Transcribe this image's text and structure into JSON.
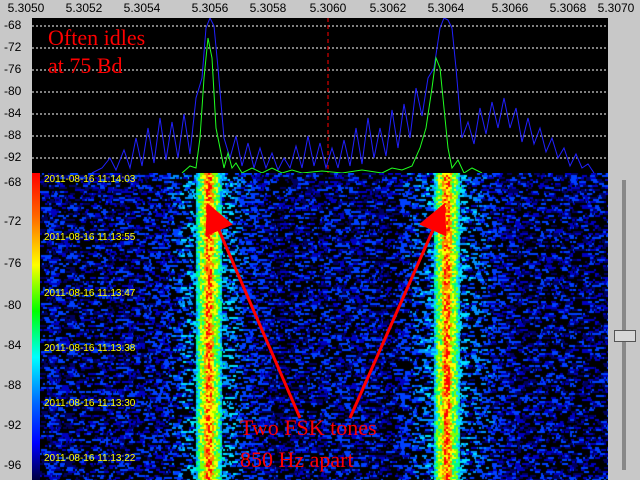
{
  "freq_axis": {
    "labels": [
      "5.3050",
      "5.3052",
      "5.3054",
      "5.3056",
      "5.3058",
      "5.3060",
      "5.3062",
      "5.3064",
      "5.3066",
      "5.3068",
      "5.3070"
    ]
  },
  "spectrum": {
    "y_labels": [
      "-68",
      "-72",
      "-76",
      "-80",
      "-84",
      "-88",
      "-92"
    ],
    "annotation_line1": "Often idles",
    "annotation_line2": "at 75 Bd"
  },
  "waterfall": {
    "y_labels": [
      "-68",
      "-72",
      "-76",
      "-80",
      "-84",
      "-88",
      "-92",
      "-96"
    ],
    "timestamps": [
      "2011-08-16 11:14:03",
      "2011-08-16 11:13:55",
      "2011-08-16 11:13:47",
      "2011-08-16 11:13:38",
      "2011-08-16 11:13:30",
      "2011-08-16 11:13:22"
    ],
    "annotation_line1": "Two FSK tones",
    "annotation_line2": "850 Hz apart"
  },
  "colors": {
    "annotation": "#ff0000",
    "trace_blue": "#2020ff",
    "trace_green": "#20ff20",
    "timestamp": "#ffff00",
    "center_marker": "#ff0000"
  }
}
